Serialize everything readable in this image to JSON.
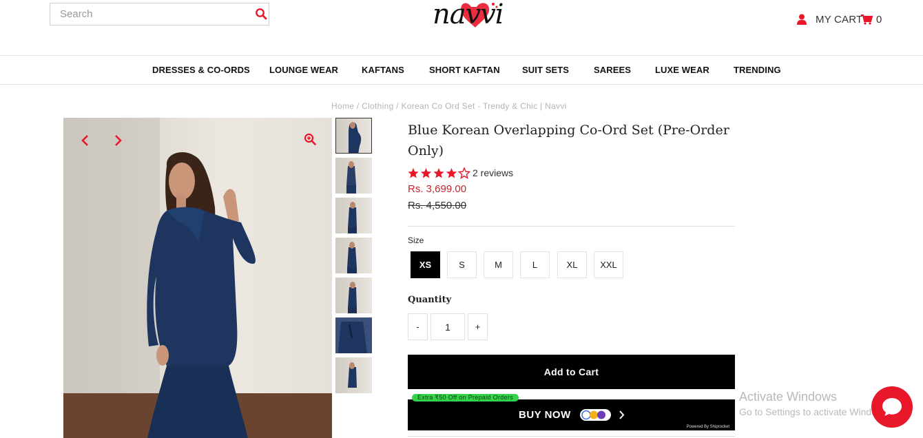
{
  "header": {
    "search": {
      "placeholder": "Search",
      "value": ""
    },
    "logo_text": "navvi",
    "cart_label": "MY CART",
    "cart_count": "0"
  },
  "nav": {
    "items": [
      "DRESSES & CO-ORDS",
      "LOUNGE WEAR",
      "KAFTANS",
      "SHORT KAFTAN",
      "SUIT SETS",
      "SAREES",
      "LUXE WEAR",
      "TRENDING"
    ]
  },
  "breadcrumb": "Home / Clothing / Korean Co Ord Set - Trendy & Chic | Navvi",
  "gallery": {
    "thumb_count": 7,
    "active_thumb": 0
  },
  "product": {
    "title": "Blue Korean Overlapping Co-Ord Set (Pre-Order Only)",
    "rating": 4,
    "rating_max": 5,
    "reviews": "2 reviews",
    "price_sale": "Rs. 3,699.00",
    "price_compare": "Rs. 4,550.00"
  },
  "size": {
    "label": "Size",
    "options": [
      "XS",
      "S",
      "M",
      "L",
      "XL",
      "XXL"
    ],
    "selected": "XS"
  },
  "quantity": {
    "label": "Quantity",
    "minus": "-",
    "plus": "+",
    "value": "1"
  },
  "actions": {
    "add_to_cart": "Add to Cart",
    "prepaid_offer": "Extra ₹50 Off on Prepaid Orders",
    "buy_now": "BUY NOW",
    "powered_by": "Powered By Shiprocket"
  },
  "overlay": {
    "activate_title": "Activate Windows",
    "activate_sub": "Go to Settings to activate Windows."
  },
  "colors": {
    "accent_red": "#e8172a",
    "price_red": "#c0262d",
    "badge_green": "#34d34a",
    "black": "#000000"
  },
  "icons": [
    "search-icon",
    "user-icon",
    "cart-icon",
    "chevron-left-icon",
    "chevron-right-icon",
    "zoom-in-icon",
    "star-icon",
    "chevron-right-icon",
    "chat-icon"
  ]
}
